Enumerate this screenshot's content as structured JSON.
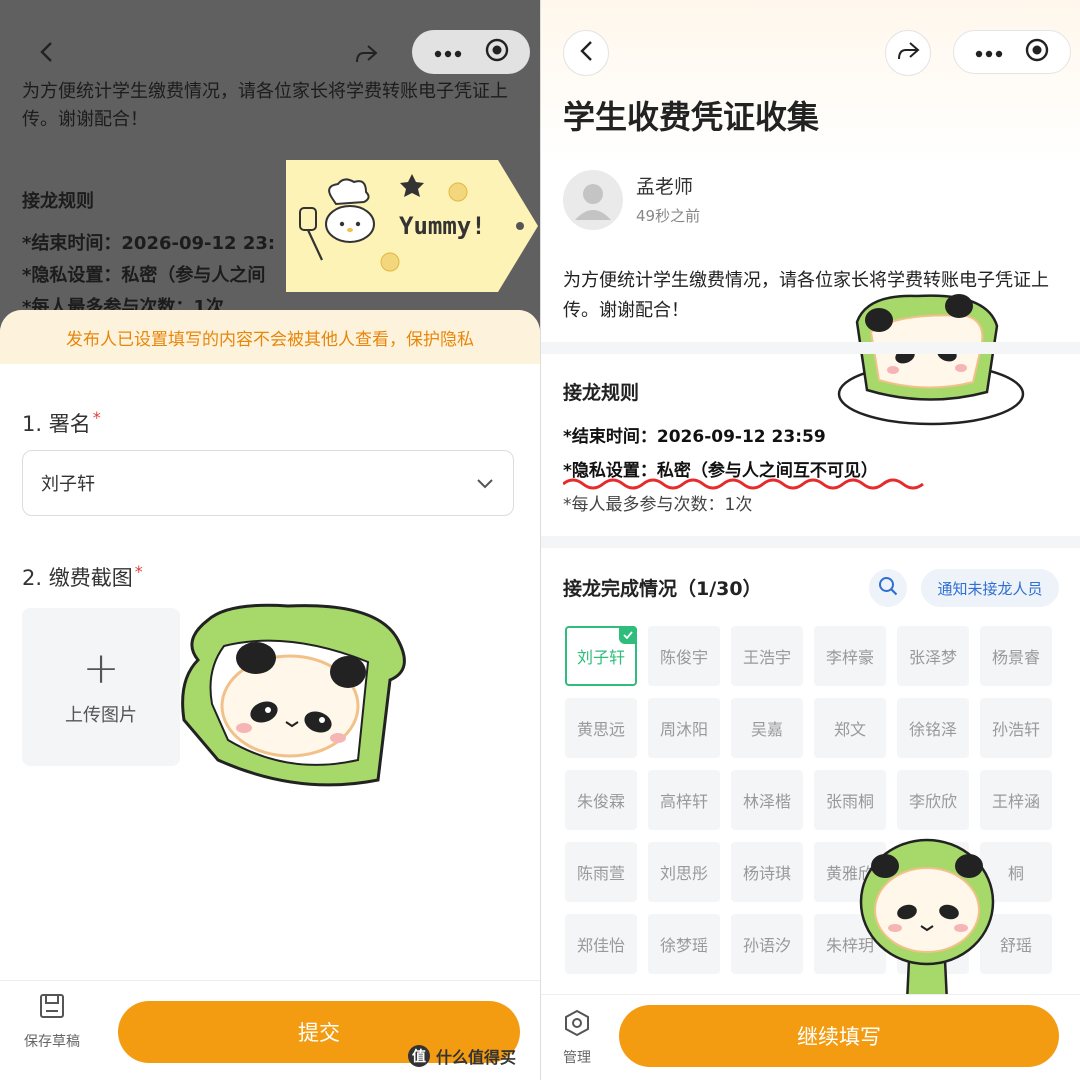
{
  "colors": {
    "accent": "#f39c12",
    "success": "#2ebd7a",
    "link": "#2f6fd1",
    "required": "#e23b3b",
    "notice": "#e8860b"
  },
  "left": {
    "background": {
      "desc": "为方便统计学生缴费情况，请各位家长将学费转账电子凭证上传。谢谢配合！",
      "rules_title": "接龙规则",
      "rule_end": "*结束时间：2026-09-12 23:",
      "rule_privacy": "*隐私设置：私密（参与人之间",
      "rule_count": "*每人最多参与次数：1次"
    },
    "sticker_text": "Yummy!",
    "notice": "发布人已设置填写的内容不会被其他人查看，保护隐私",
    "q1": {
      "label": "1. 署名",
      "required": "*",
      "value": "刘子轩"
    },
    "q2": {
      "label": "2. 缴费截图",
      "required": "*",
      "upload_label": "上传图片",
      "plus": "+"
    },
    "bottom": {
      "save_draft": "保存草稿",
      "submit": "提交"
    }
  },
  "right": {
    "title": "学生收费凭证收集",
    "author": {
      "name": "孟老师",
      "time": "49秒之前"
    },
    "desc": "为方便统计学生缴费情况，请各位家长将学费转账电子凭证上传。谢谢配合！",
    "rules": {
      "title": "接龙规则",
      "end_time": "*结束时间：2026-09-12 23:59",
      "privacy": "*隐私设置：私密（参与人之间互不可见）",
      "max_times": "*每人最多参与次数：1次"
    },
    "status": {
      "title": "接龙完成情况（1/30）",
      "notify": "通知未接龙人员"
    },
    "participants": [
      {
        "name": "刘子轩",
        "done": true
      },
      {
        "name": "陈俊宇",
        "done": false
      },
      {
        "name": "王浩宇",
        "done": false
      },
      {
        "name": "李梓豪",
        "done": false
      },
      {
        "name": "张泽梦",
        "done": false
      },
      {
        "name": "杨景睿",
        "done": false
      },
      {
        "name": "黄思远",
        "done": false
      },
      {
        "name": "周沐阳",
        "done": false
      },
      {
        "name": "吴嘉",
        "done": false
      },
      {
        "name": "郑文",
        "done": false
      },
      {
        "name": "徐铭泽",
        "done": false
      },
      {
        "name": "孙浩轩",
        "done": false
      },
      {
        "name": "朱俊霖",
        "done": false
      },
      {
        "name": "高梓轩",
        "done": false
      },
      {
        "name": "林泽楷",
        "done": false
      },
      {
        "name": "张雨桐",
        "done": false
      },
      {
        "name": "李欣欣",
        "done": false
      },
      {
        "name": "王梓涵",
        "done": false
      },
      {
        "name": "陈雨萱",
        "done": false
      },
      {
        "name": "刘思彤",
        "done": false
      },
      {
        "name": "杨诗琪",
        "done": false
      },
      {
        "name": "黄雅欣",
        "done": false
      },
      {
        "name": "",
        "done": false
      },
      {
        "name": "桐",
        "done": false
      },
      {
        "name": "郑佳怡",
        "done": false
      },
      {
        "name": "徐梦瑶",
        "done": false
      },
      {
        "name": "孙语汐",
        "done": false
      },
      {
        "name": "朱梓玥",
        "done": false
      },
      {
        "name": "",
        "done": false
      },
      {
        "name": "舒瑶",
        "done": false
      }
    ],
    "bottom": {
      "manage": "管理",
      "continue": "继续填写"
    }
  },
  "watermark": {
    "badge": "值",
    "text": "什么值得买"
  },
  "icons": [
    "back-icon",
    "share-icon",
    "more-icon",
    "target-icon",
    "chevron-down-icon",
    "save-icon",
    "search-icon",
    "check-icon",
    "hexagon-gear-icon",
    "person-icon"
  ]
}
